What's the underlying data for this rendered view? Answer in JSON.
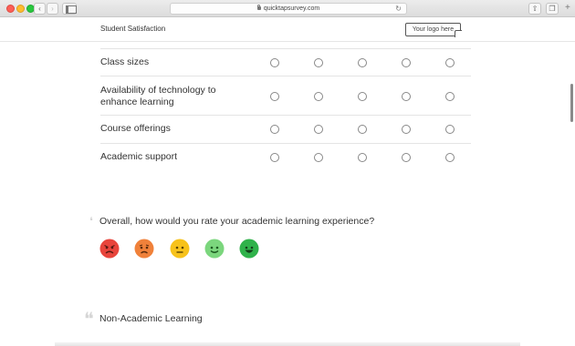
{
  "browser": {
    "url": "quicktapsurvey.com",
    "back_icon": "chevron-left-icon",
    "forward_icon": "chevron-right-icon",
    "reload_icon": "reload-icon",
    "plus_label": "+"
  },
  "survey": {
    "title": "Student Satisfaction",
    "logo_text": "Your logo here"
  },
  "matrix": {
    "rows": [
      {
        "label": "Class sizes"
      },
      {
        "label": "Availability of technology to enhance learning"
      },
      {
        "label": "Course offerings"
      },
      {
        "label": "Academic support"
      }
    ],
    "options_per_row": 5
  },
  "rating": {
    "question": "Overall, how would you rate your academic learning experience?",
    "faces": [
      {
        "name": "angry",
        "color": "#e8453c"
      },
      {
        "name": "sad",
        "color": "#f0813a"
      },
      {
        "name": "neutral",
        "color": "#f7c21b"
      },
      {
        "name": "happy",
        "color": "#7bd67d"
      },
      {
        "name": "very-happy",
        "color": "#2fb24a"
      }
    ]
  },
  "next_section": {
    "title": "Non-Academic Learning"
  }
}
